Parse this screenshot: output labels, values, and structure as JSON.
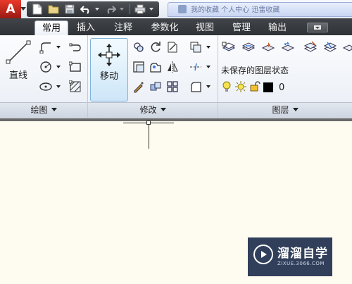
{
  "app": {
    "logo_letter": "A"
  },
  "title_tab": {
    "text": "我的收藏  个人中心  迅雷收藏"
  },
  "tabs": [
    {
      "label": "常用",
      "active": true
    },
    {
      "label": "插入",
      "active": false
    },
    {
      "label": "注释",
      "active": false
    },
    {
      "label": "参数化",
      "active": false
    },
    {
      "label": "视图",
      "active": false
    },
    {
      "label": "管理",
      "active": false
    },
    {
      "label": "输出",
      "active": false
    }
  ],
  "panels": {
    "draw": {
      "footer": "绘图",
      "line_button": "直线"
    },
    "modify": {
      "footer": "修改",
      "move_button": "移动"
    },
    "layers": {
      "footer": "图层",
      "layer_state": "未保存的图层状态",
      "current_layer": "0"
    }
  },
  "watermark": {
    "title": "溜溜自学",
    "subtitle": "ZIXUE.3066.COM"
  },
  "colors": {
    "ribbon_bg": "#eef2f8",
    "tabbar_bg": "#3a3d41",
    "canvas_bg": "#fefbf0",
    "hover_blue": "#cde6f8",
    "app_red": "#c8281a"
  }
}
